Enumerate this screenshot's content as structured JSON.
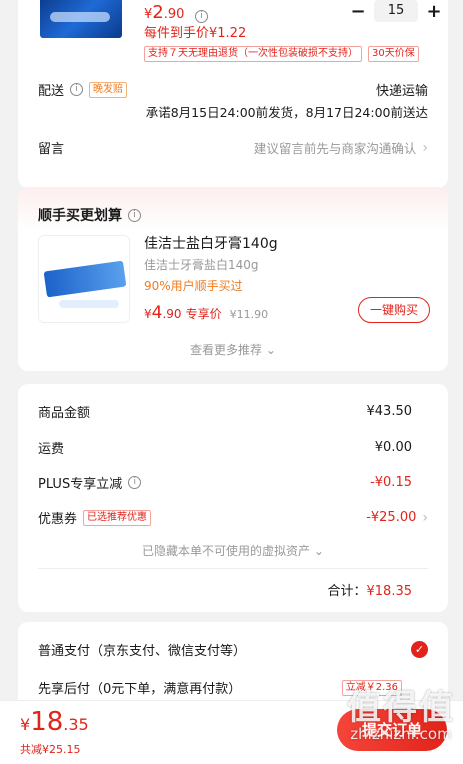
{
  "product": {
    "price_integer": "2",
    "price_decimal": ".90",
    "currency": "¥",
    "unit_price_text": "每件到手价¥1.22",
    "quantity": "15",
    "minus": "−",
    "plus": "+",
    "return_policy_tag": "支持７天无理由退货（一次性包装破损不支持）",
    "price_protect_tag": "30天价保"
  },
  "delivery": {
    "label": "配送",
    "info_icon": "i",
    "late_tag": "晚发赔",
    "method": "快递运输",
    "promise": "承诺8月15日24:00前发货，8月17日24:00前送达"
  },
  "message": {
    "label": "留言",
    "placeholder": "建议留言前先与商家沟通确认"
  },
  "addon": {
    "title": "顺手买更划算",
    "item_name": "佳洁士盐白牙膏140g",
    "item_spec": "佳洁士牙膏盐白140g",
    "item_note": "90%用户顺手买过",
    "price_currency": "¥",
    "price_int": "4",
    "price_dec": ".90",
    "price_label": "专享价",
    "orig_price": "¥11.90",
    "buy_button": "一键购买",
    "more": "查看更多推荐"
  },
  "summary": {
    "rows": [
      {
        "label": "商品金额",
        "value": "¥43.50",
        "red": false
      },
      {
        "label": "运费",
        "value": "¥0.00",
        "red": false
      },
      {
        "label": "PLUS专享立减",
        "value": "-¥0.15",
        "red": true
      },
      {
        "label": "优惠券",
        "value": "-¥25.00",
        "red": true
      }
    ],
    "coupon_tag": "已选推荐优惠",
    "hidden_assets": "已隐藏本单不可使用的虚拟资产",
    "total_label": "合计：",
    "total_value": "¥18.35"
  },
  "payment": {
    "option1": "普通支付（京东支付、微信支付等）",
    "option2": "先享后付（0元下单，满意再付款）",
    "option2_tag": "立减￥2.36"
  },
  "footer": {
    "currency": "¥",
    "total_int": "18",
    "total_dec": ".35",
    "saved": "共减¥25.15",
    "submit": "提交订单"
  },
  "watermark": {
    "cn": "值得值",
    "url": "zhizhizhi.com"
  },
  "colors": {
    "accent": "#e2231a",
    "orange": "#f07b1f"
  }
}
